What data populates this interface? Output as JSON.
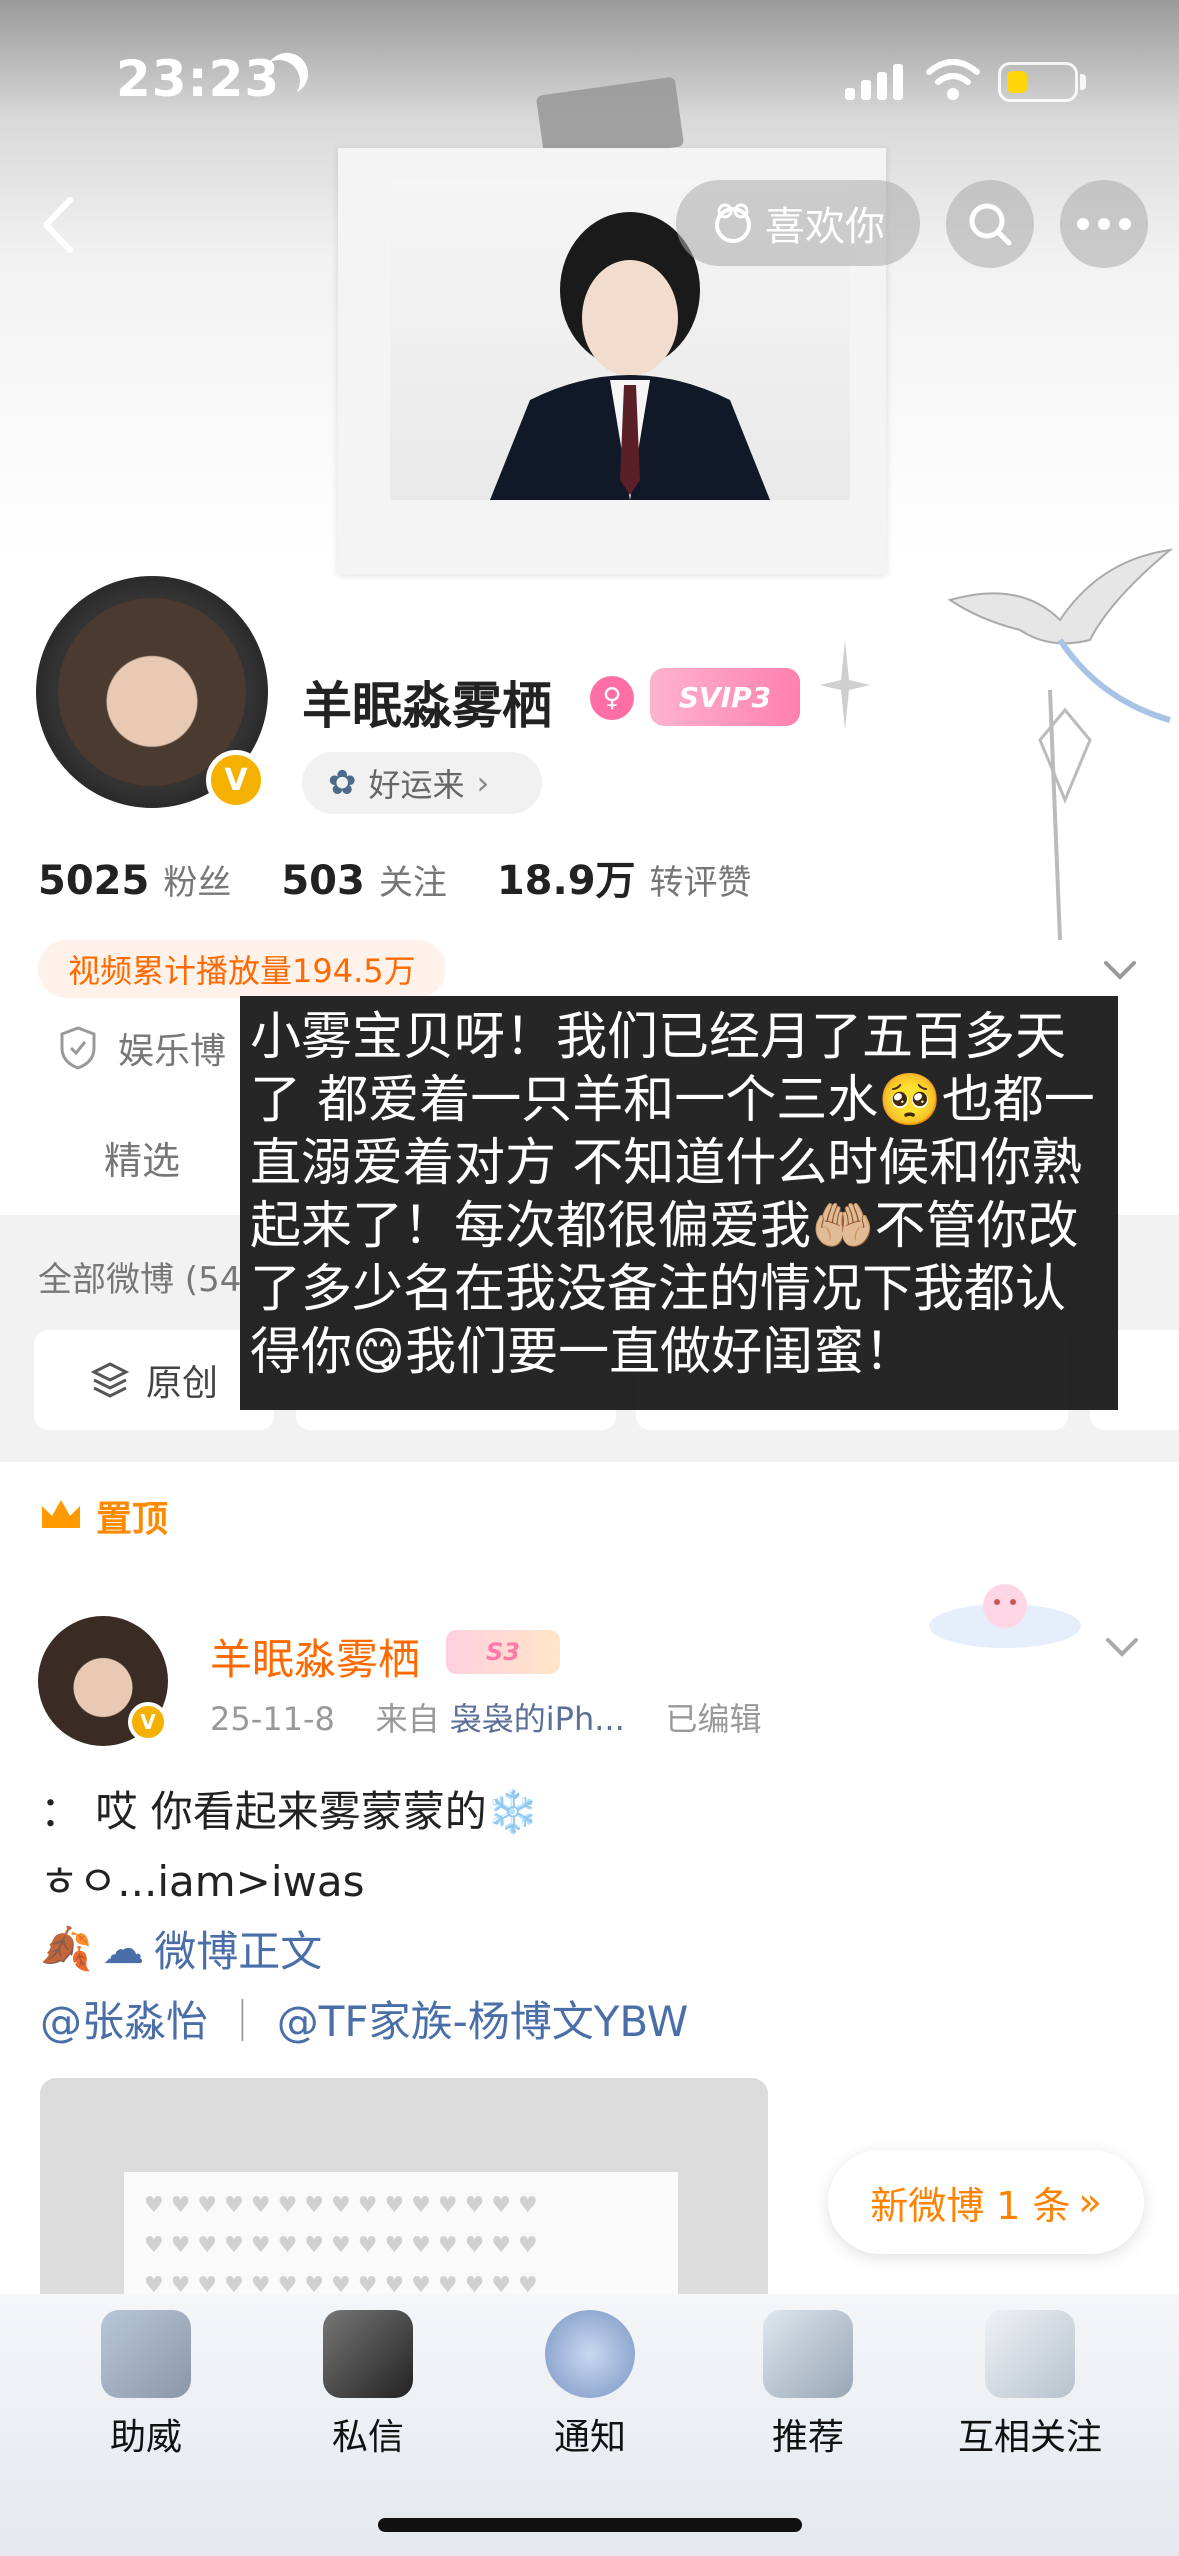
{
  "status_bar": {
    "time": "23:23"
  },
  "top_nav": {
    "like_label": "喜欢你"
  },
  "profile": {
    "name": "羊眠淼雾栖",
    "svip_badge": "SVIP3",
    "luck_label": "好运来",
    "stats": [
      {
        "value": "5025",
        "label": "粉丝"
      },
      {
        "value": "503",
        "label": "关注"
      },
      {
        "value": "18.9万",
        "label": "转评赞"
      }
    ],
    "video_views": "视频累计播放量194.5万",
    "entertainment_label": "娱乐博",
    "tab_selected": "精选"
  },
  "feed": {
    "filter_label": "全部微博 (54",
    "chip_original": "原创",
    "pinned_label": "置顶",
    "new_weibo": "新微博 1 条"
  },
  "post": {
    "author": "羊眠淼雾栖",
    "level_badge": "S3",
    "date": "25-11-8",
    "from_label": "来自",
    "source": "袅袅的iPh...",
    "edited": "已编辑",
    "line1": "： 哎 你看起来雾蒙蒙的❄️",
    "line2": "ㅎㅇ...iam>iwas",
    "line3_link": "微博正文",
    "mention1": "@张淼怡",
    "separator": "｜",
    "mention2": "@TF家族-杨博文YBW"
  },
  "overlay": {
    "text": "小雾宝贝呀！我们已经月了五百多天了 都爱着一只羊和一个三水🥺也都一直溺爱着对方 不知道什么时候和你熟起来了！每次都很偏爱我🤲🏼不管你改了多少名在我没备注的情况下我都认得你😋我们要一直做好闺蜜！"
  },
  "bottom_nav": {
    "items": [
      {
        "label": "助威"
      },
      {
        "label": "私信"
      },
      {
        "label": "通知"
      },
      {
        "label": "推荐"
      },
      {
        "label": "互相关注"
      }
    ]
  },
  "colors": {
    "accent": "#ff8200",
    "orange_name": "#ff6a00",
    "link": "#4a6ea8",
    "verify": "#f6b100"
  }
}
